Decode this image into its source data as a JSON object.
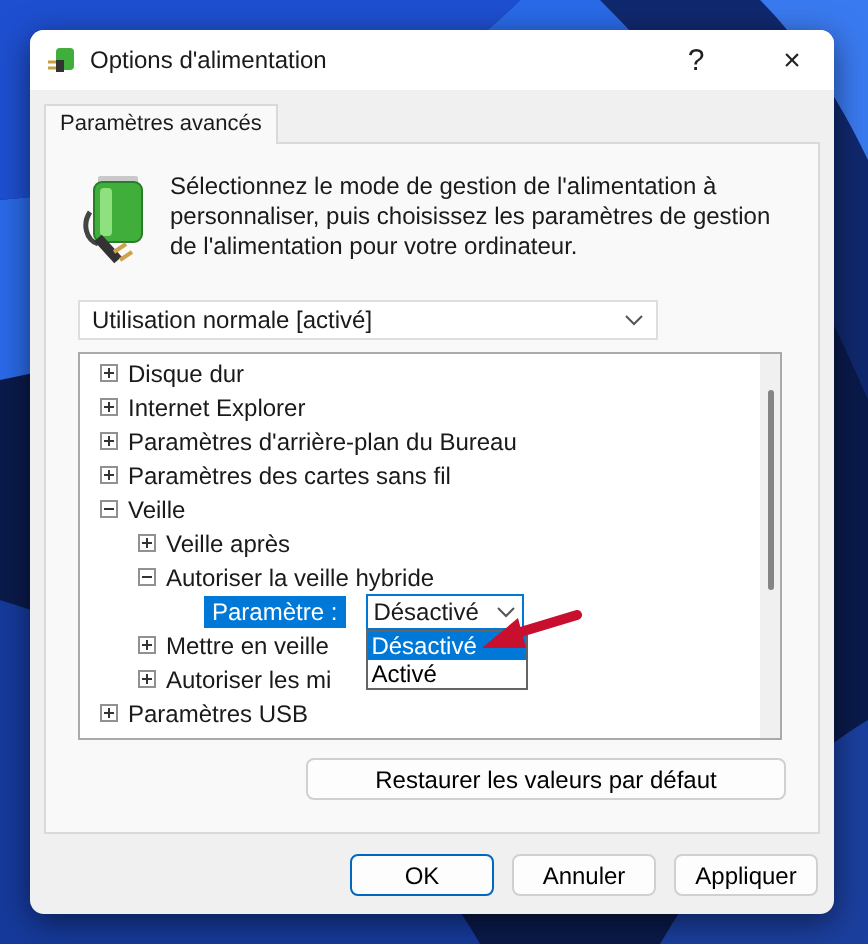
{
  "window": {
    "title": "Options d'alimentation",
    "help": "?",
    "close": "×"
  },
  "tabs": [
    {
      "label": "Paramètres avancés",
      "selected": true
    }
  ],
  "intro": [
    "Sélectionnez le mode de gestion de l'alimentation à",
    "personnaliser, puis choisissez les paramètres de gestion",
    "de l'alimentation pour votre ordinateur."
  ],
  "plan_select": {
    "value": "Utilisation normale [activé]"
  },
  "tree": [
    {
      "label": "Disque dur",
      "expanded": false
    },
    {
      "label": "Internet Explorer",
      "expanded": false
    },
    {
      "label": "Paramètres d'arrière-plan du Bureau",
      "expanded": false
    },
    {
      "label": "Paramètres des cartes sans fil",
      "expanded": false
    },
    {
      "label": "Veille",
      "expanded": true,
      "children": [
        {
          "label": "Veille après",
          "expanded": false
        },
        {
          "label": "Autoriser la veille hybride",
          "expanded": true,
          "setting": {
            "label": "Paramètre :",
            "value": "Désactivé",
            "options": [
              {
                "label": "Désactivé",
                "selected": true
              },
              {
                "label": "Activé",
                "selected": false
              }
            ]
          }
        },
        {
          "label": "Mettre en veille",
          "expanded": false
        },
        {
          "label": "Autoriser les mi",
          "expanded": false
        }
      ]
    },
    {
      "label": "Paramètres USB",
      "expanded": false
    }
  ],
  "restore_button": "Restaurer les valeurs par défaut",
  "buttons": [
    {
      "label": "OK",
      "kind": "default"
    },
    {
      "label": "Annuler",
      "kind": "normal"
    },
    {
      "label": "Appliquer",
      "kind": "normal"
    }
  ]
}
